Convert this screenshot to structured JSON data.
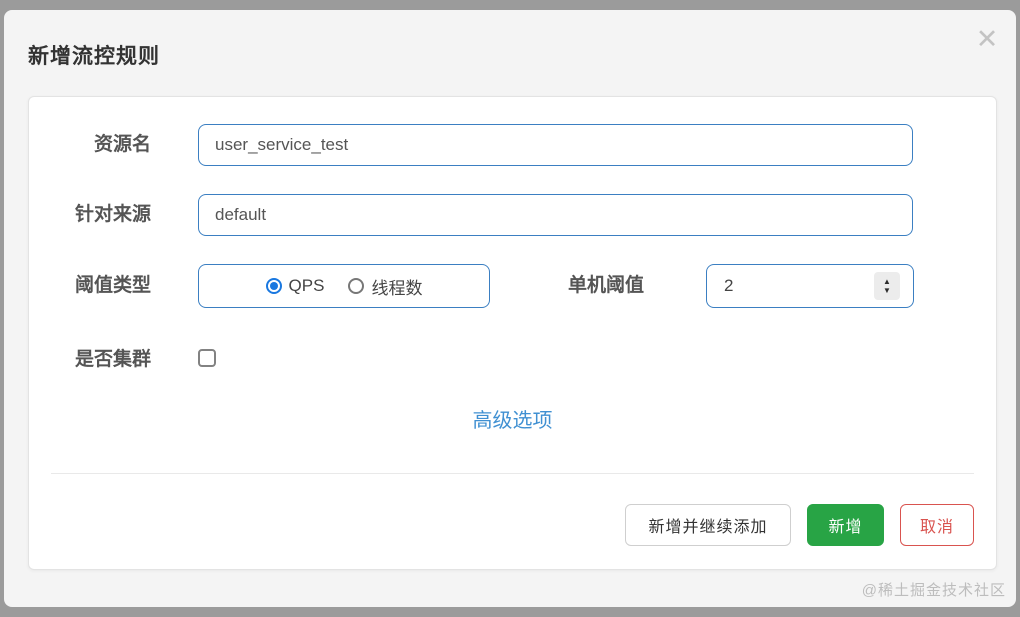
{
  "dialog": {
    "title": "新增流控规则",
    "close_icon": "✕"
  },
  "form": {
    "resource": {
      "label": "资源名",
      "value": "user_service_test"
    },
    "source": {
      "label": "针对来源",
      "value": "default"
    },
    "threshold_type": {
      "label": "阈值类型",
      "options": [
        {
          "label": "QPS",
          "selected": true
        },
        {
          "label": "线程数",
          "selected": false
        }
      ]
    },
    "single_threshold": {
      "label": "单机阈值",
      "value": "2",
      "spinner_up": "▲",
      "spinner_down": "▼"
    },
    "cluster": {
      "label": "是否集群",
      "checked": false
    },
    "advanced_link": "高级选项"
  },
  "footer": {
    "add_continue_label": "新增并继续添加",
    "add_label": "新增",
    "cancel_label": "取消"
  },
  "watermark": "@稀土掘金技术社区",
  "colors": {
    "backdrop": "#9b9b9b",
    "dialog_bg": "#f4f4f4",
    "panel_bg": "#ffffff",
    "input_border_blue": "#3b7fc2",
    "radio_selected_blue": "#1a78e0",
    "link_blue": "#4090d2",
    "add_button_green": "#28a445",
    "cancel_red": "#d9534f"
  }
}
